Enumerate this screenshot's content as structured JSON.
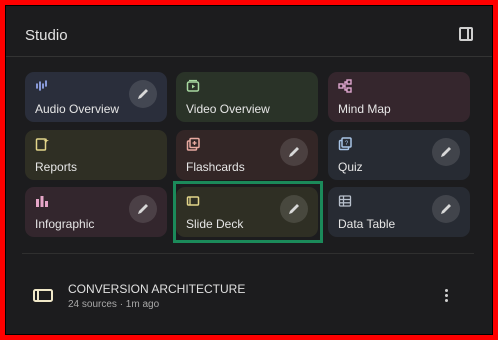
{
  "panel": {
    "title": "Studio"
  },
  "cards": {
    "audio_overview": "Audio Overview",
    "video_overview": "Video Overview",
    "mind_map": "Mind Map",
    "reports": "Reports",
    "flashcards": "Flashcards",
    "quiz": "Quiz",
    "infographic": "Infographic",
    "slide_deck": "Slide Deck",
    "data_table": "Data Table"
  },
  "note": {
    "title": "CONVERSION ARCHITECTURE",
    "meta": "24 sources · 1m ago"
  },
  "colors": {
    "highlight": "#1b8a5a",
    "panel_bg": "#1c1c1e",
    "frame": "#ff0000"
  }
}
